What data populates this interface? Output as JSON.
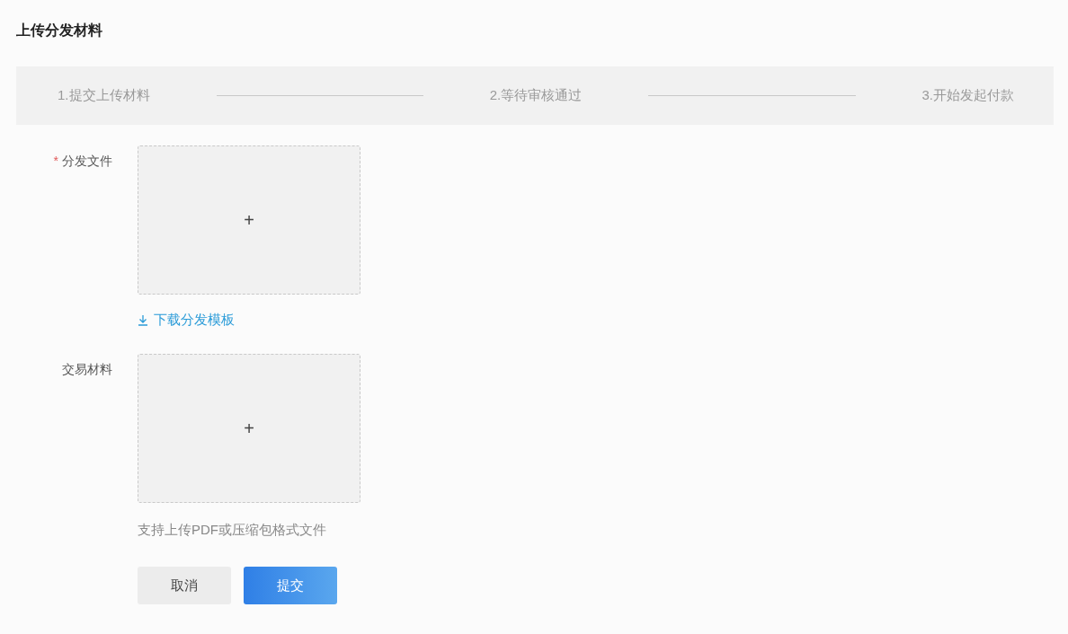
{
  "title": "上传分发材料",
  "steps": [
    {
      "label": "1.提交上传材料"
    },
    {
      "label": "2.等待审核通过"
    },
    {
      "label": "3.开始发起付款"
    }
  ],
  "fields": [
    {
      "label": "分发文件",
      "required_mark": "*",
      "upload_icon": "+",
      "link": "下载分发模板"
    },
    {
      "label": "交易材料",
      "upload_icon": "+",
      "hint": "支持上传PDF或压缩包格式文件"
    }
  ],
  "buttons": [
    {
      "label": "取消",
      "kind": "secondary"
    },
    {
      "label": "提交",
      "kind": "primary"
    }
  ]
}
